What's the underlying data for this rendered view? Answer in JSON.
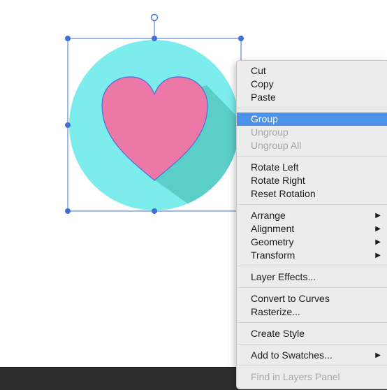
{
  "canvas": {
    "background": "#ffffff",
    "artwork": {
      "circle_color": "#7deced",
      "heart_color": "#ec78a7",
      "shadow_color": "#5ccec8",
      "outline_color": "#4a6fd8"
    },
    "selection": {
      "handle_color": "#3d6fd6"
    }
  },
  "context_menu": {
    "highlight_color": "#4a92ea",
    "groups": [
      [
        {
          "label": "Cut"
        },
        {
          "label": "Copy"
        },
        {
          "label": "Paste"
        }
      ],
      [
        {
          "label": "Group",
          "highlighted": true
        },
        {
          "label": "Ungroup",
          "disabled": true
        },
        {
          "label": "Ungroup All",
          "disabled": true
        }
      ],
      [
        {
          "label": "Rotate Left"
        },
        {
          "label": "Rotate Right"
        },
        {
          "label": "Reset Rotation"
        }
      ],
      [
        {
          "label": "Arrange",
          "submenu": true
        },
        {
          "label": "Alignment",
          "submenu": true
        },
        {
          "label": "Geometry",
          "submenu": true
        },
        {
          "label": "Transform",
          "submenu": true
        }
      ],
      [
        {
          "label": "Layer Effects..."
        }
      ],
      [
        {
          "label": "Convert to Curves"
        },
        {
          "label": "Rasterize..."
        }
      ],
      [
        {
          "label": "Create Style"
        }
      ],
      [
        {
          "label": "Add to Swatches...",
          "submenu": true
        }
      ],
      [
        {
          "label": "Find in Layers Panel",
          "disabled": true
        }
      ]
    ]
  }
}
